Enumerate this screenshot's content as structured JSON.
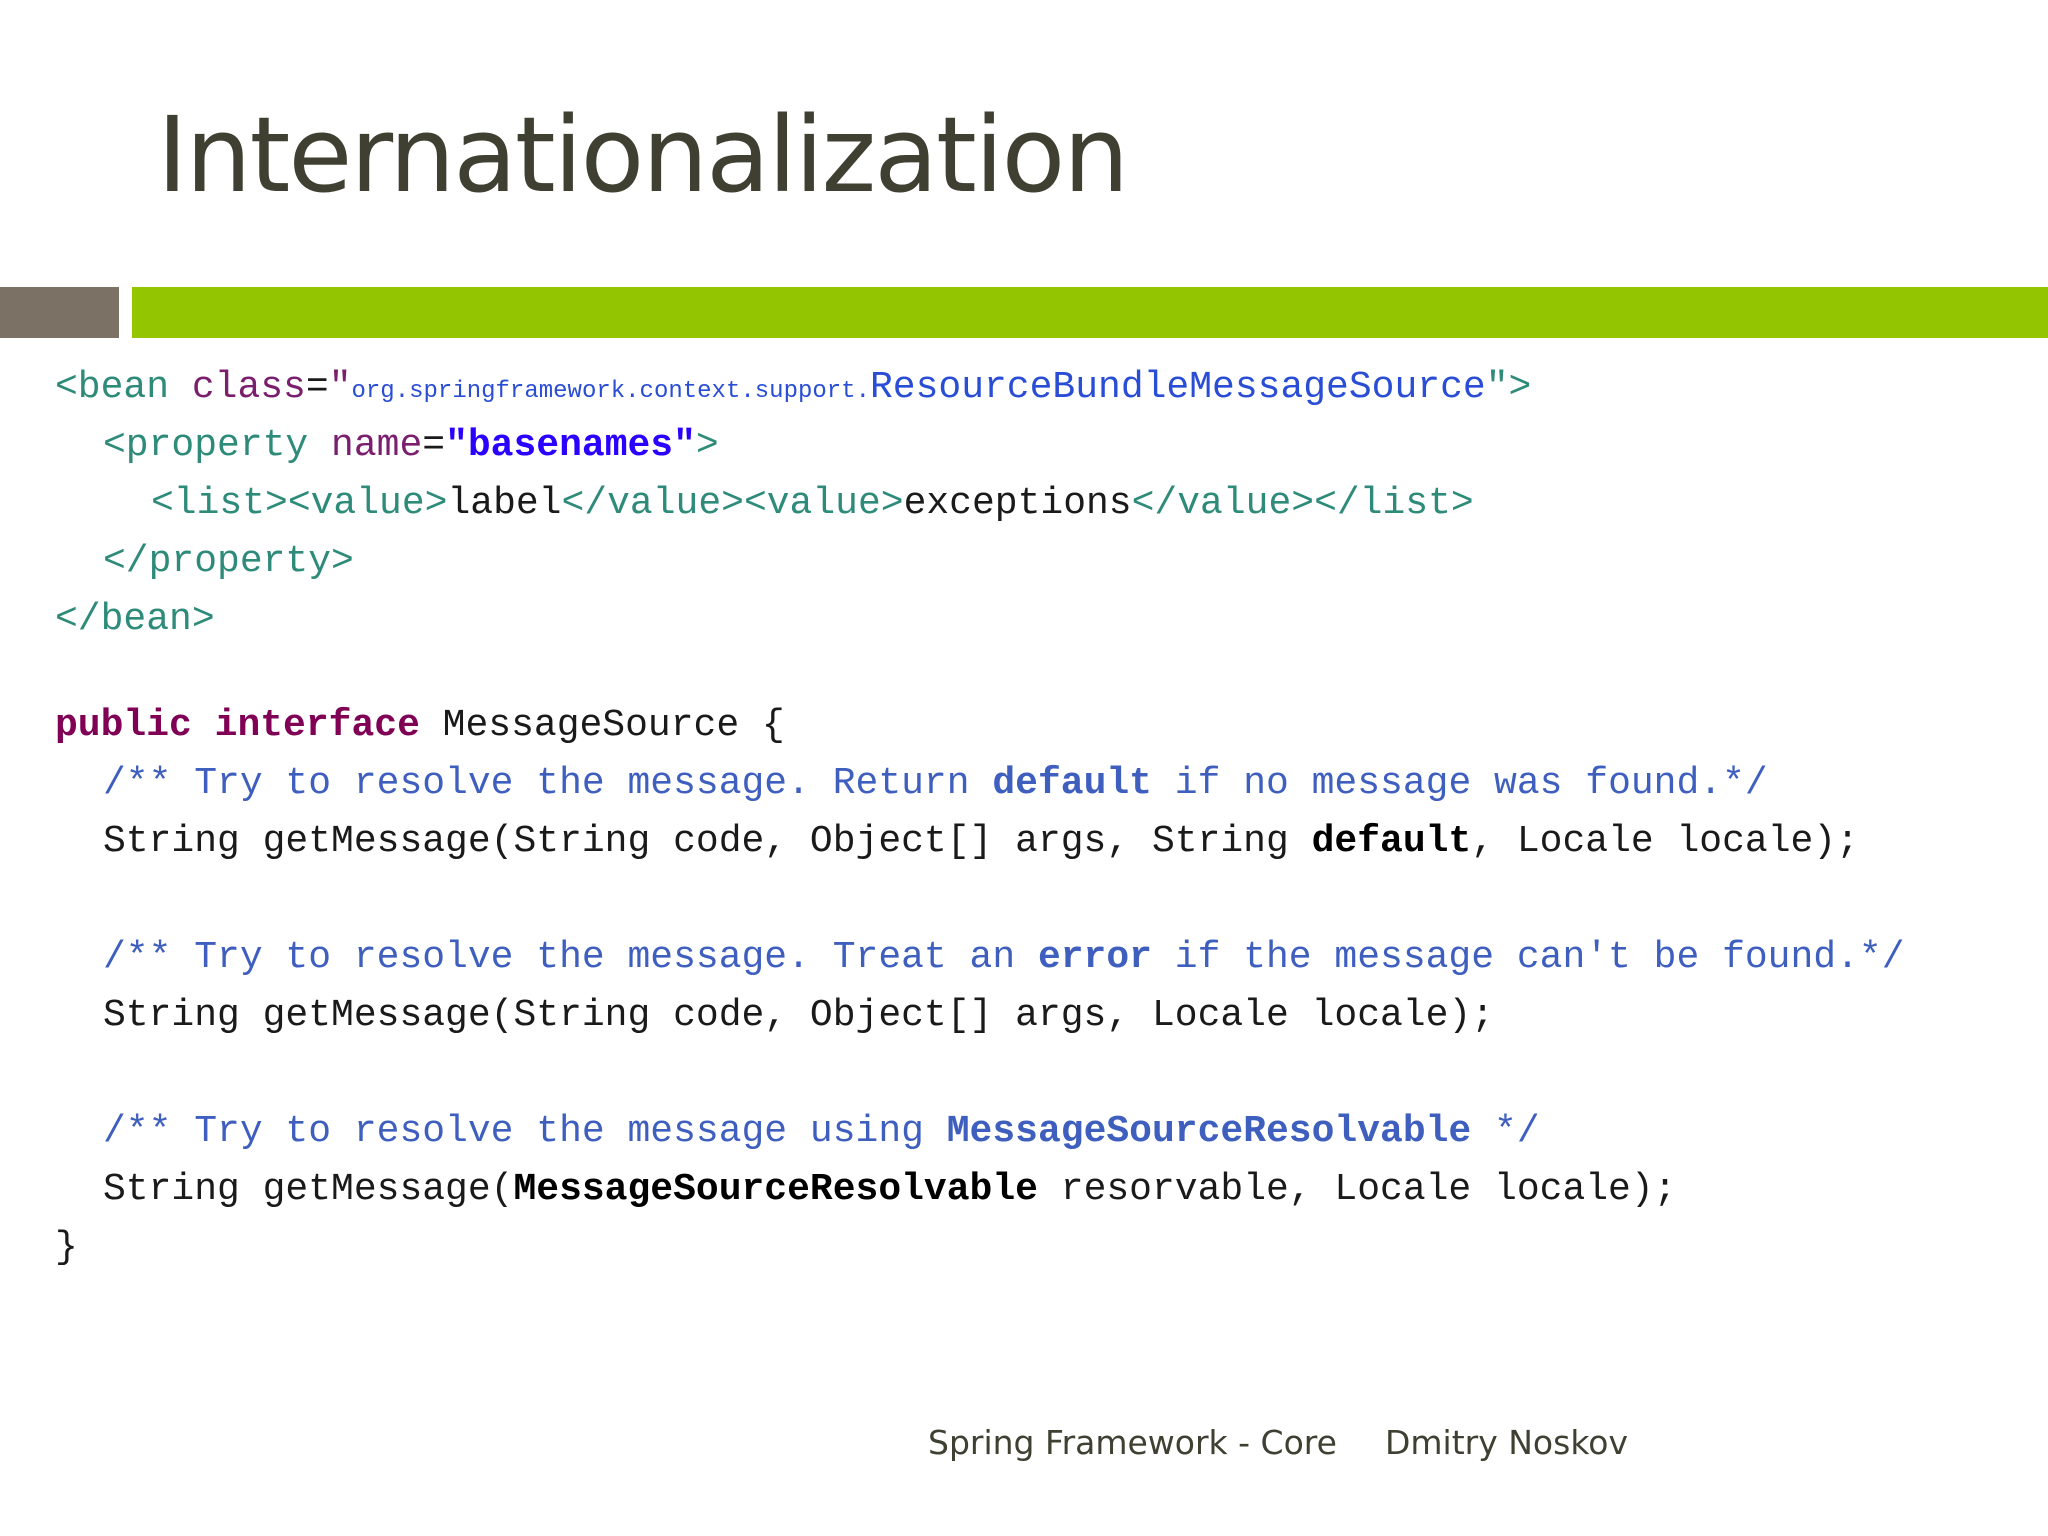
{
  "slide": {
    "title": "Internationalization",
    "footer": {
      "course": "Spring Framework - Core",
      "author": "Dmitry Noskov"
    }
  },
  "colors": {
    "title_text": "#3f3f32",
    "bar_gray": "#7b7265",
    "bar_green": "#94c600",
    "xml_tag": "#2e8b7a",
    "xml_attr": "#7a1f6e",
    "xml_string": "#2a00ff",
    "keyword": "#7f0055",
    "comment": "#3f5fbf"
  },
  "xml_code": {
    "bean_open": "<bean",
    "class_attr": "class",
    "eq": "=",
    "quote": "\"",
    "package": "org.springframework.context.support.",
    "class_name": "ResourceBundleMessageSource",
    "bean_open_end": "\">",
    "property_open": "<property",
    "name_attr": "name",
    "basenames_value": "\"basenames\"",
    "tag_close": ">",
    "list_open": "<list>",
    "value_open": "<value>",
    "label": "label",
    "value_close": "</value>",
    "exceptions": "exceptions",
    "list_close": "</list>",
    "property_close": "</property>",
    "bean_close": "</bean>"
  },
  "java_code": {
    "kw_public": "public",
    "kw_interface": "interface",
    "iface_decl": " MessageSource {",
    "comment1_a": "/** Try to resolve the message. Return ",
    "comment1_bold": "default",
    "comment1_b": " if no message was found.*/",
    "method1_a": "String getMessage(String code, Object[] args, String ",
    "method1_bold": "default",
    "method1_b": ", Locale locale);",
    "comment2_a": "/** Try to resolve the message. Treat an ",
    "comment2_bold": "error",
    "comment2_b": " if the message can't be found.*/",
    "method2": "String getMessage(String code, Object[] args, Locale locale);",
    "comment3_a": "/** Try to resolve the message using ",
    "comment3_bold": "MessageSourceResolvable",
    "comment3_b": " */",
    "method3_a": "String getMessage(",
    "method3_bold": "MessageSourceResolvable",
    "method3_b": " resorvable, Locale locale);",
    "close_brace": "}"
  }
}
